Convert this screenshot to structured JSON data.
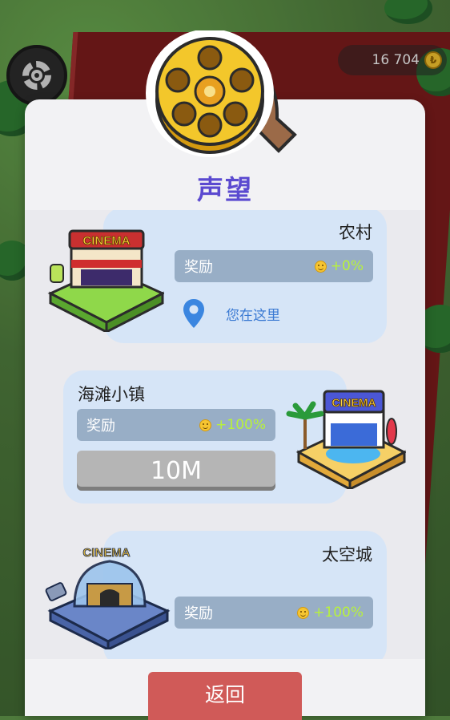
{
  "hud": {
    "coins": "16 704",
    "coin_symbol": "₺"
  },
  "modal": {
    "title": "声望",
    "back_label": "返回"
  },
  "locations": [
    {
      "name": "农村",
      "reward_label": "奖励",
      "reward_value": "+0%",
      "status": "您在这里",
      "building_sign": "CINEMA"
    },
    {
      "name": "海滩小镇",
      "reward_label": "奖励",
      "reward_value": "+100%",
      "price": "10M",
      "building_sign": "CINEMA"
    },
    {
      "name": "太空城",
      "reward_label": "奖励",
      "reward_value": "+100%",
      "building_sign": "CINEMA"
    }
  ],
  "colors": {
    "title": "#5b4ad0",
    "card_bg": "#d6e5f7",
    "reward_bar": "#98aec6",
    "reward_value": "#b8f23a",
    "price_button": "#b5b5b5",
    "back_button": "#d05a58"
  }
}
